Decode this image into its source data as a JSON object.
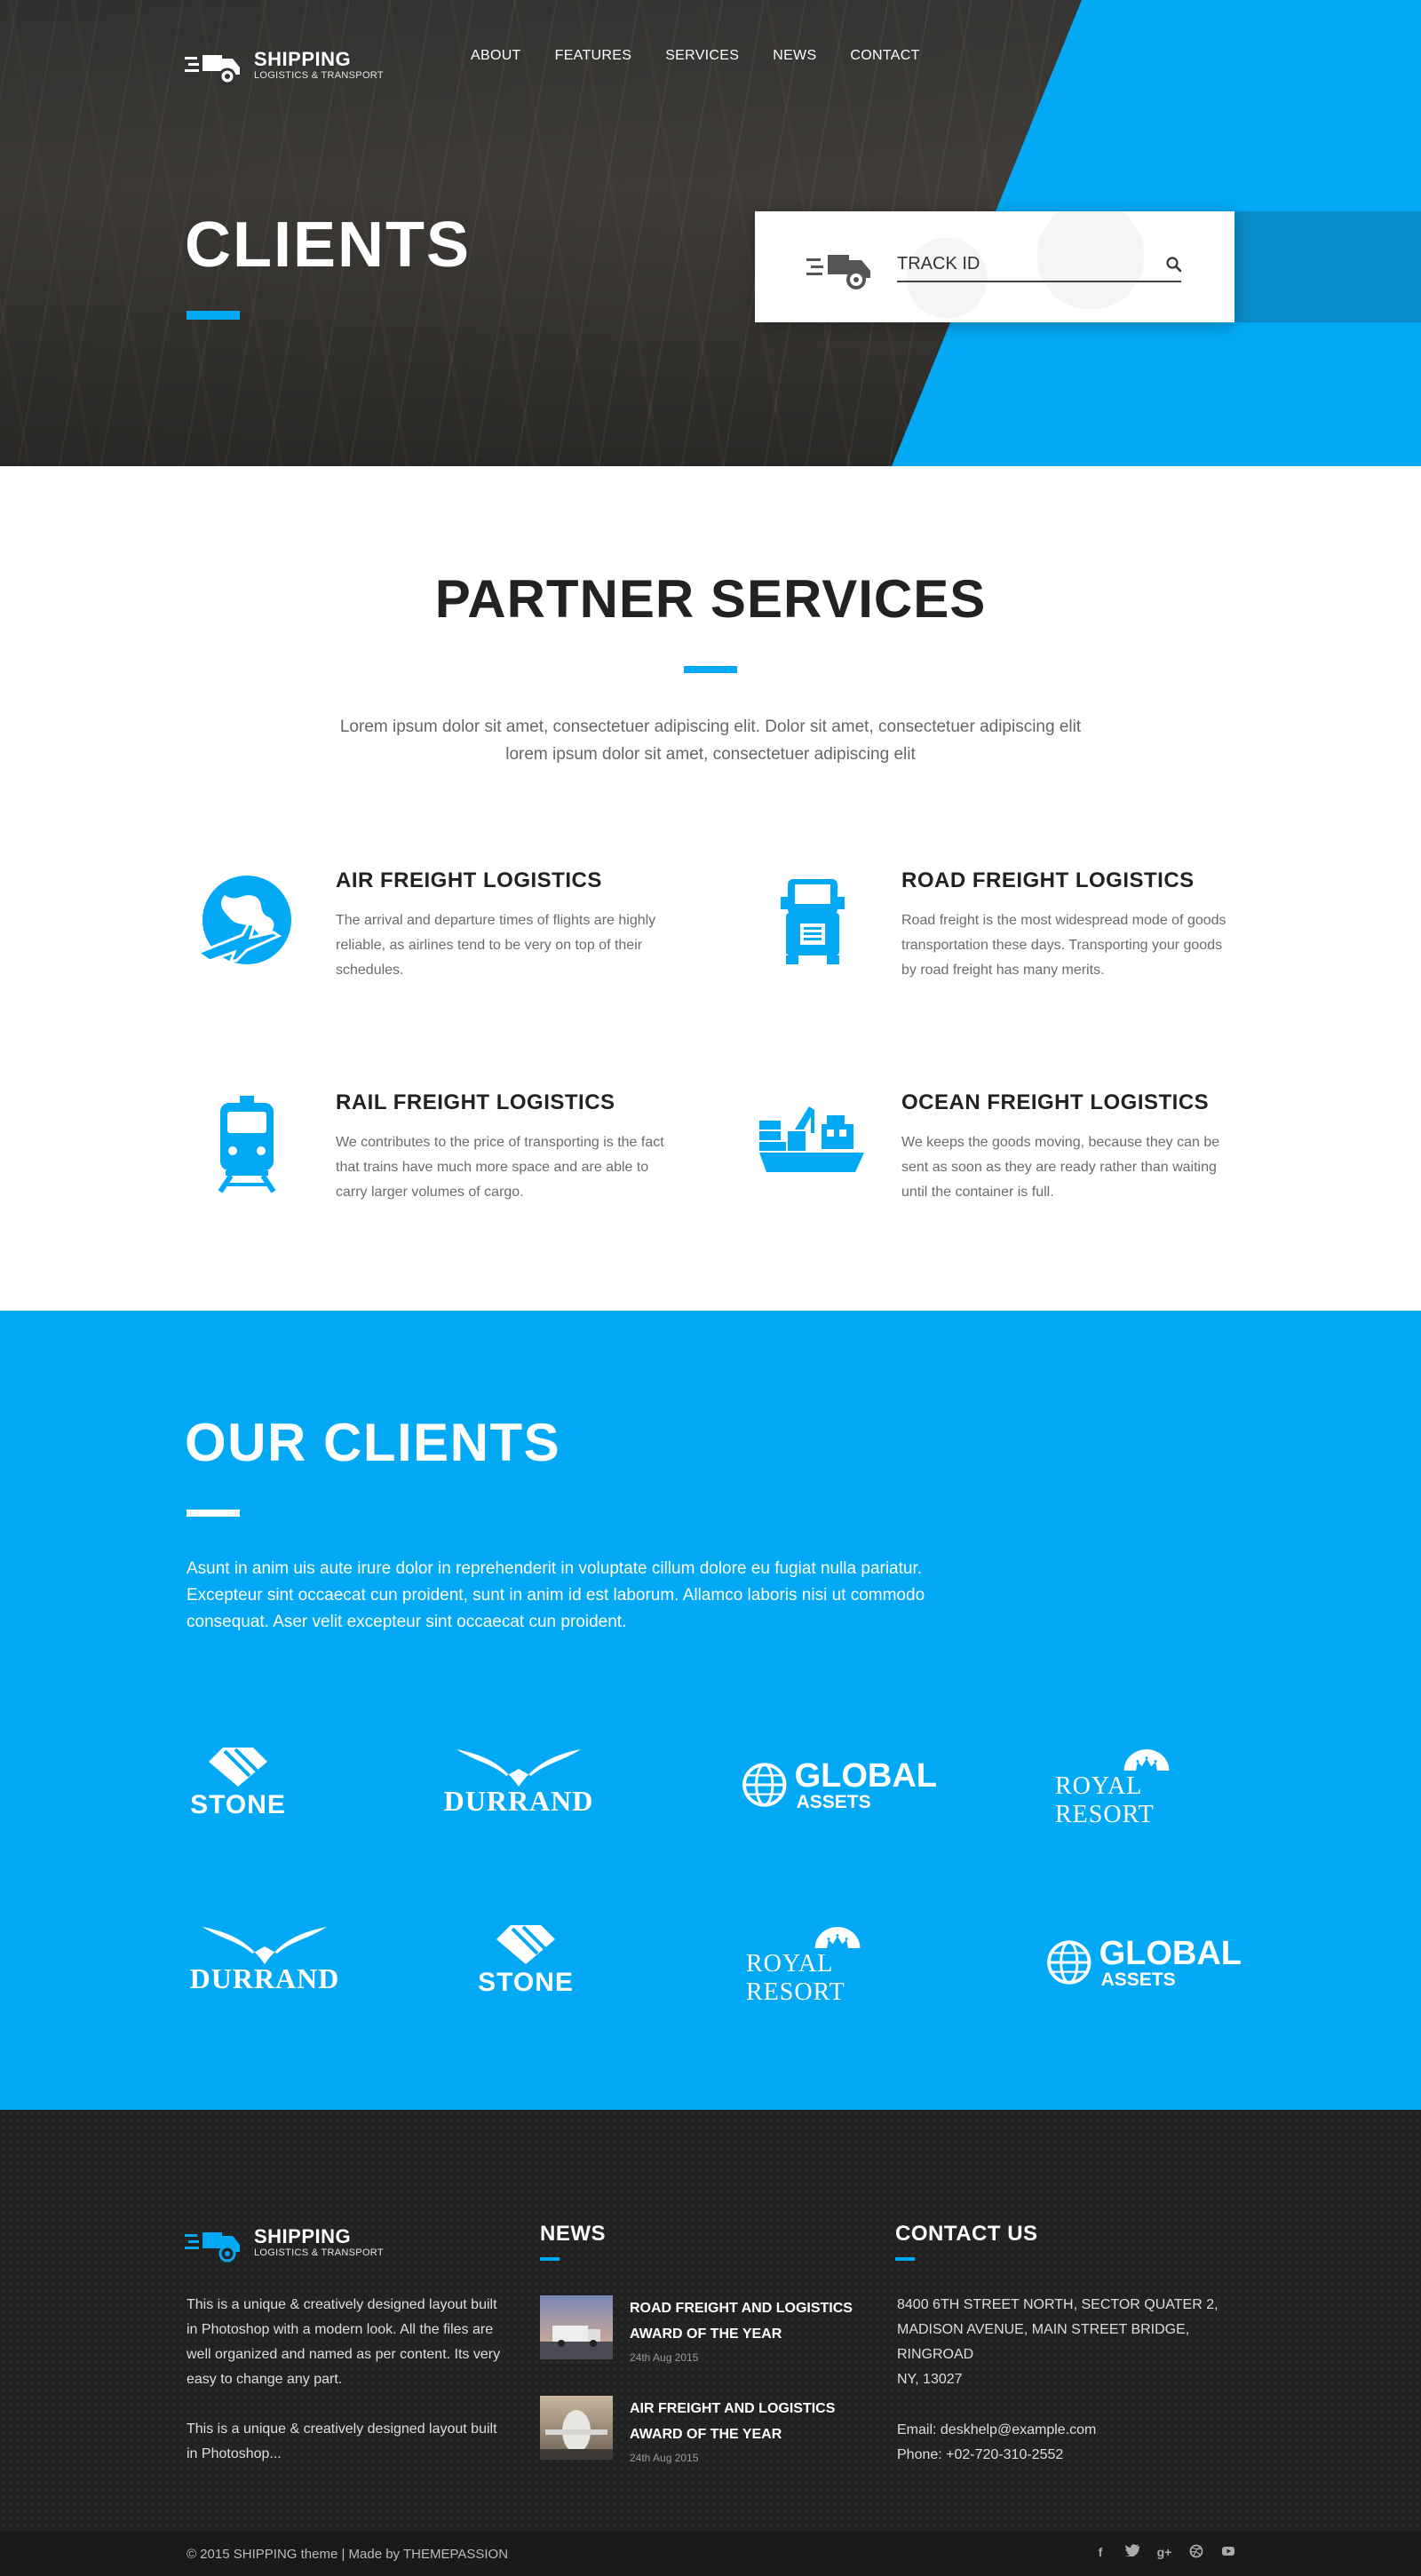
{
  "brand": {
    "name": "SHIPPING",
    "tagline": "LOGISTICS & TRANSPORT"
  },
  "nav": [
    "ABOUT",
    "FEATURES",
    "SERVICES",
    "NEWS",
    "CONTACT"
  ],
  "hero": {
    "title": "CLIENTS",
    "track_placeholder": "TRACK ID"
  },
  "partner": {
    "title": "PARTNER SERVICES",
    "description": "Lorem ipsum dolor sit amet, consectetuer adipiscing elit. Dolor sit amet, consectetuer adipiscing elit lorem ipsum dolor sit amet, consectetuer adipiscing elit",
    "services": [
      {
        "title": "AIR FREIGHT LOGISTICS",
        "text": "The arrival and departure times of flights are highly reliable, as airlines tend to be very on top of their schedules.",
        "icon": "globe-plane-icon"
      },
      {
        "title": "ROAD FREIGHT LOGISTICS",
        "text": "Road freight is the most widespread mode of goods transportation these days. Transporting your goods by road freight has many merits.",
        "icon": "truck-icon"
      },
      {
        "title": "RAIL FREIGHT LOGISTICS",
        "text": "We contributes to the price of transporting is the fact that trains have much more space and are able to carry larger volumes of cargo.",
        "icon": "train-icon"
      },
      {
        "title": "OCEAN FREIGHT LOGISTICS",
        "text": "We keeps the goods moving, because they can be sent as soon as they are ready rather than waiting until the container is full.",
        "icon": "ship-icon"
      }
    ]
  },
  "clients": {
    "title": "OUR CLIENTS",
    "description": "Asunt in anim uis aute irure dolor in reprehenderit in voluptate cillum dolore eu fugiat nulla pariatur. Excepteur sint occaecat cun proident, sunt in anim id est laborum. Allamco laboris nisi ut commodo consequat. Aser velit excepteur sint occaecat cun proident.",
    "logos": {
      "stone": "STONE",
      "durrand": "DURRAND",
      "global": "GLOBAL",
      "assets": "ASSETS",
      "royal": "ROYAL RESORT"
    }
  },
  "footer": {
    "about_1": "This is a unique & creatively designed layout built in Photoshop with a modern look. All the files are well organized and named as per content. Its very easy to change any part.",
    "about_2": "This is a unique & creatively designed layout built in Photoshop...",
    "news_title": "NEWS",
    "news": [
      {
        "title": "ROAD FREIGHT AND LOGISTICS AWARD OF THE YEAR",
        "date": "24th Aug 2015"
      },
      {
        "title": "AIR FREIGHT AND LOGISTICS AWARD OF THE YEAR",
        "date": "24th Aug 2015"
      }
    ],
    "contact_title": "CONTACT US",
    "address_1": "8400 6TH STREET NORTH, SECTOR QUATER 2,",
    "address_2": "MADISON AVENUE, MAIN STREET BRIDGE,",
    "address_3": "RINGROAD",
    "address_4": "NY, 13027",
    "email": "Email: deskhelp@example.com",
    "phone": "Phone: +02-720-310-2552",
    "copyright": "© 2015 SHIPPING theme | Made by THEMEPASSION",
    "socials": [
      "facebook-icon",
      "twitter-icon",
      "google-plus-icon",
      "dribbble-icon",
      "youtube-icon"
    ]
  },
  "colors": {
    "accent": "#03a9f4",
    "dark": "#222222"
  }
}
